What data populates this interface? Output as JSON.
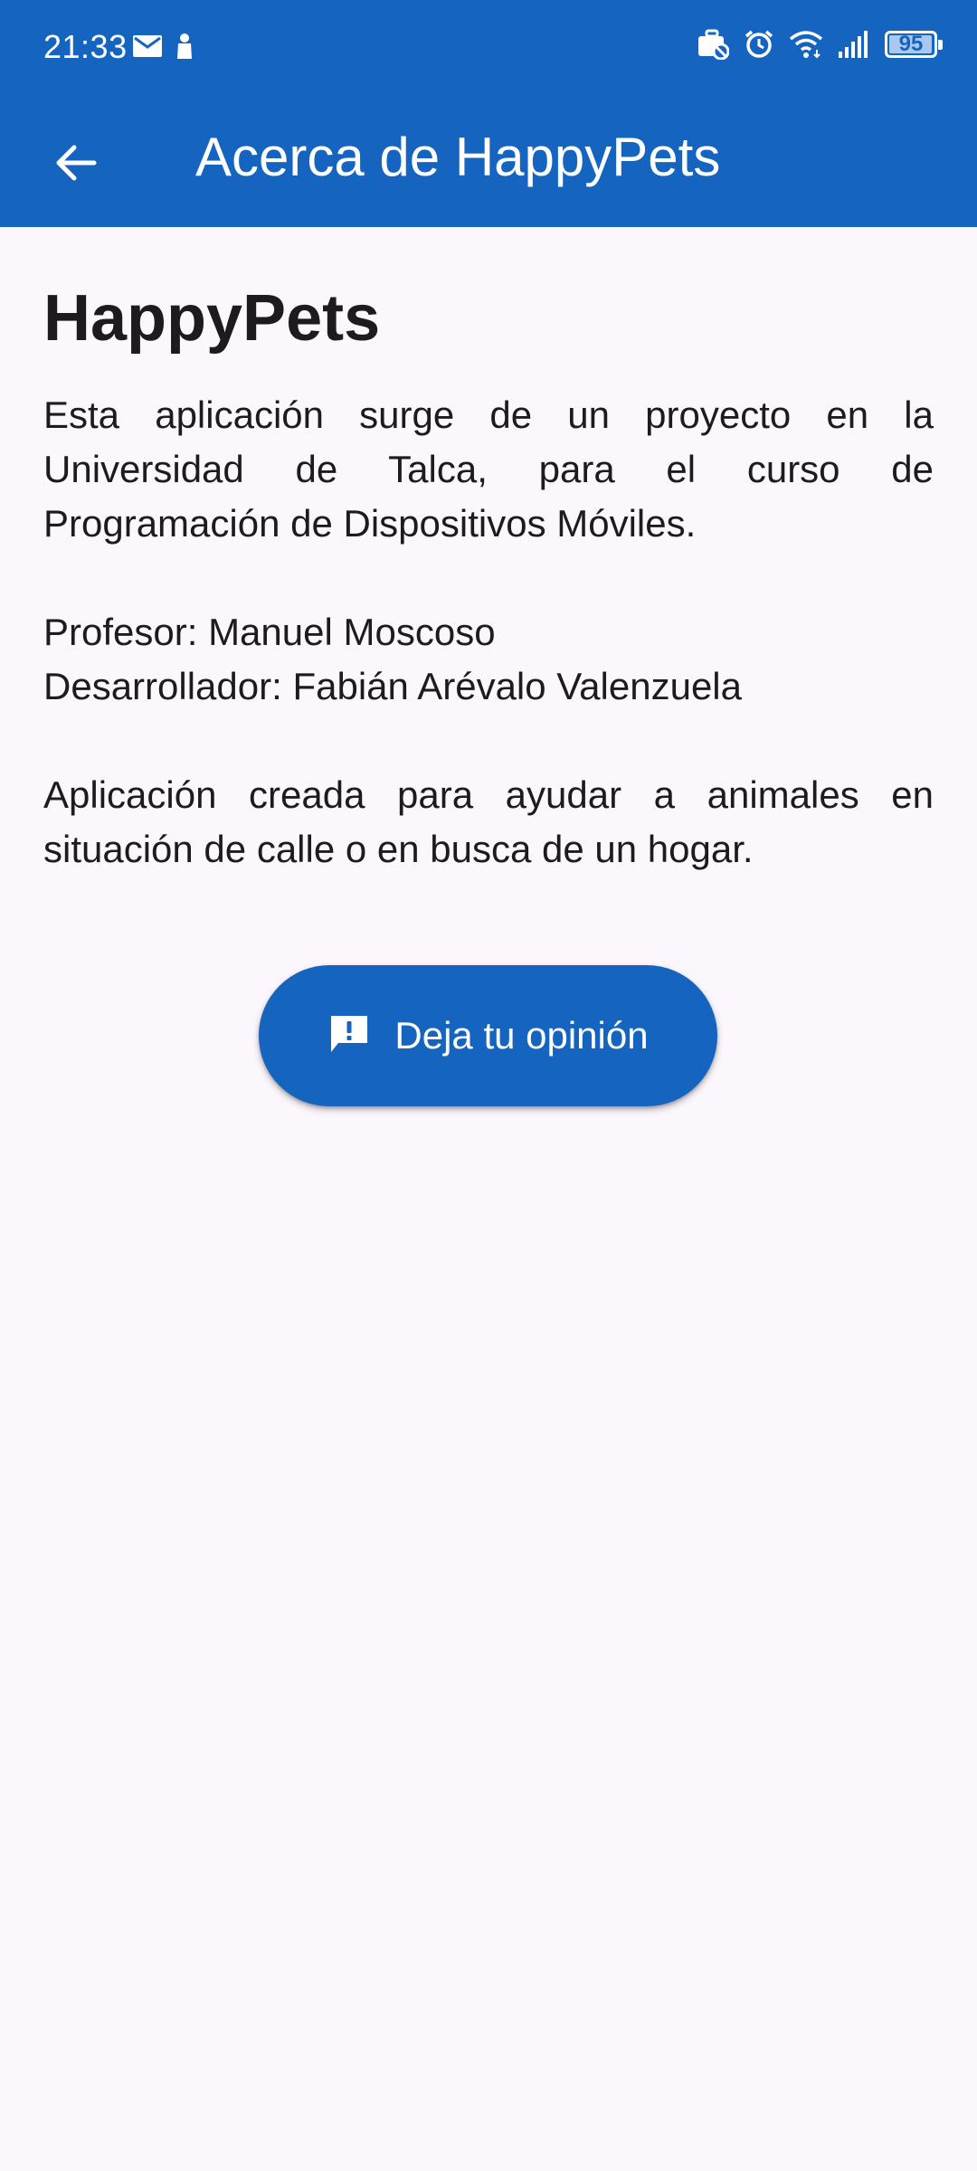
{
  "status_bar": {
    "time": "21:33",
    "battery_level": "95",
    "left_icons": [
      "mail-icon",
      "notification-person-icon"
    ],
    "right_icons": [
      "briefcase-off-icon",
      "alarm-icon",
      "wifi-icon",
      "signal-icon",
      "battery-icon"
    ]
  },
  "app_bar": {
    "title": "Acerca de HappyPets",
    "back_icon": "arrow-back-icon",
    "color": "#1565C0"
  },
  "content": {
    "app_name": "HappyPets",
    "intro": "Esta aplicación surge de un proyecto en la Universidad de Talca, para el curso de Programación de Dispositivos Móviles.",
    "professor": "Profesor: Manuel Moscoso",
    "developer": "Desarrollador: Fabián Arévalo Valenzuela",
    "purpose": "Aplicación creada para ayudar a animales en situación de calle o en busca de un hogar."
  },
  "feedback_button": {
    "label": "Deja tu opinión",
    "icon": "feedback-icon"
  },
  "colors": {
    "primary": "#1565C0",
    "background": "#FCF7FC",
    "text": "#1D1B20"
  }
}
